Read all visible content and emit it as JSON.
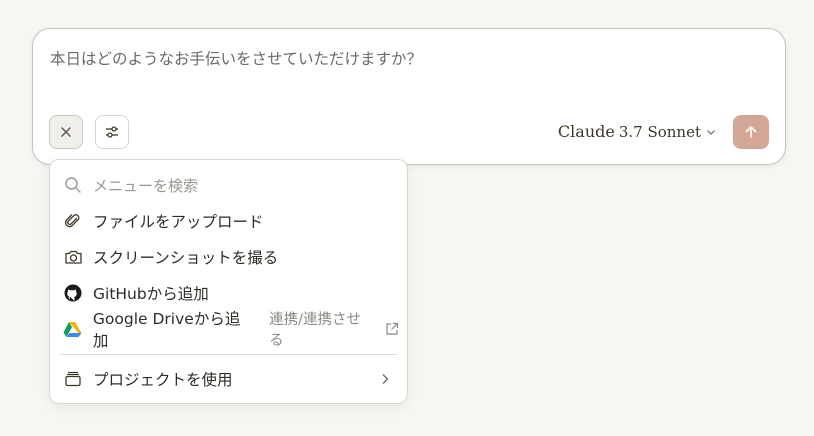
{
  "composer": {
    "placeholder": "本日はどのようなお手伝いをさせていただけますか？",
    "model_name": "Claude",
    "model_version": "3.7 Sonnet",
    "close_icon": "close-icon",
    "settings_icon": "sliders-icon",
    "send_icon": "arrow-up-icon"
  },
  "menu": {
    "search_placeholder": "メニューを検索",
    "items": [
      {
        "label": "ファイルをアップロード",
        "icon": "paperclip-icon"
      },
      {
        "label": "スクリーンショットを撮る",
        "icon": "camera-icon"
      },
      {
        "label": "GitHubから追加",
        "icon": "github-icon"
      },
      {
        "label": "Google Driveから追加",
        "icon": "google-drive-icon",
        "link_label": "連携/連携させる"
      },
      {
        "label": "プロジェクトを使用",
        "icon": "project-icon"
      }
    ]
  },
  "colors": {
    "background": "#f8f6f2",
    "send_button": "#d4a698",
    "text": "#3d3929"
  }
}
